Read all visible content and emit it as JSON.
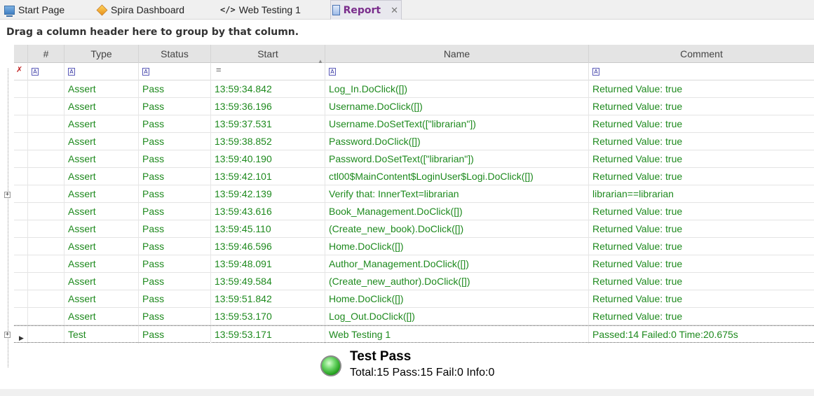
{
  "tabs": [
    {
      "label": "Start Page",
      "icon": "start-page-icon"
    },
    {
      "label": "Spira Dashboard",
      "icon": "cube-icon"
    },
    {
      "label": "Web Testing 1",
      "icon": "code-icon"
    },
    {
      "label": "Report",
      "icon": "report-icon",
      "active": true,
      "close": "✕"
    }
  ],
  "group_panel": {
    "text": "Drag a column header here to group by that column."
  },
  "grid": {
    "columns": [
      "#",
      "Type",
      "Status",
      "Start",
      "Name",
      "Comment"
    ],
    "sorted_column": "Start",
    "filter_equals": "=",
    "text_color": "#1e8a1e",
    "rows": [
      {
        "type": "Assert",
        "status": "Pass",
        "start": "13:59:34.842",
        "name": "Log_In.DoClick([])",
        "comment": "Returned Value: true"
      },
      {
        "type": "Assert",
        "status": "Pass",
        "start": "13:59:36.196",
        "name": "Username.DoClick([])",
        "comment": "Returned Value: true"
      },
      {
        "type": "Assert",
        "status": "Pass",
        "start": "13:59:37.531",
        "name": "Username.DoSetText([\"librarian\"])",
        "comment": "Returned Value: true"
      },
      {
        "type": "Assert",
        "status": "Pass",
        "start": "13:59:38.852",
        "name": "Password.DoClick([])",
        "comment": "Returned Value: true"
      },
      {
        "type": "Assert",
        "status": "Pass",
        "start": "13:59:40.190",
        "name": "Password.DoSetText([\"librarian\"])",
        "comment": "Returned Value: true"
      },
      {
        "type": "Assert",
        "status": "Pass",
        "start": "13:59:42.101",
        "name": "ctl00$MainContent$LoginUser$Logi.DoClick([])",
        "comment": "Returned Value: true"
      },
      {
        "type": "Assert",
        "status": "Pass",
        "start": "13:59:42.139",
        "name": "Verify that: InnerText=librarian",
        "comment": "librarian==librarian"
      },
      {
        "type": "Assert",
        "status": "Pass",
        "start": "13:59:43.616",
        "name": "Book_Management.DoClick([])",
        "comment": "Returned Value: true"
      },
      {
        "type": "Assert",
        "status": "Pass",
        "start": "13:59:45.110",
        "name": "(Create_new_book).DoClick([])",
        "comment": "Returned Value: true"
      },
      {
        "type": "Assert",
        "status": "Pass",
        "start": "13:59:46.596",
        "name": "Home.DoClick([])",
        "comment": "Returned Value: true"
      },
      {
        "type": "Assert",
        "status": "Pass",
        "start": "13:59:48.091",
        "name": "Author_Management.DoClick([])",
        "comment": "Returned Value: true"
      },
      {
        "type": "Assert",
        "status": "Pass",
        "start": "13:59:49.584",
        "name": "(Create_new_author).DoClick([])",
        "comment": "Returned Value: true"
      },
      {
        "type": "Assert",
        "status": "Pass",
        "start": "13:59:51.842",
        "name": "Home.DoClick([])",
        "comment": "Returned Value: true"
      },
      {
        "type": "Assert",
        "status": "Pass",
        "start": "13:59:53.170",
        "name": "Log_Out.DoClick([])",
        "comment": "Returned Value: true"
      },
      {
        "type": "Test",
        "status": "Pass",
        "start": "13:59:53.171",
        "name": "Web Testing 1",
        "comment": "Passed:14 Failed:0 Time:20.675s"
      }
    ]
  },
  "summary": {
    "title": "Test Pass",
    "detail": "Total:15 Pass:15 Fail:0 Info:0",
    "status_color": "#25a01f"
  }
}
